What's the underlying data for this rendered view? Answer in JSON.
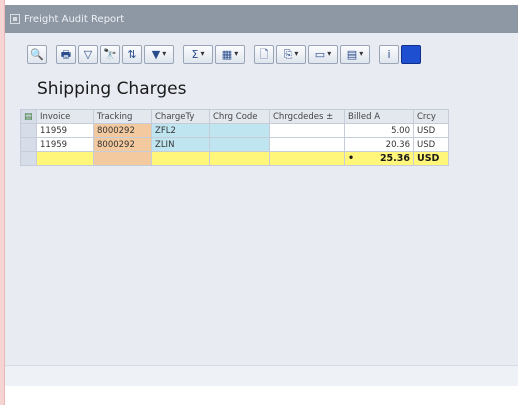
{
  "window": {
    "title": "Freight Audit Report"
  },
  "page": {
    "heading": "Shipping Charges"
  },
  "toolbar": {
    "buttons": [
      {
        "icon": "magnify-icon",
        "glyph": "🔍"
      },
      {
        "icon": "print-icon",
        "glyph": "🖶"
      },
      {
        "icon": "filter-icon",
        "glyph": "▽"
      },
      {
        "icon": "find-icon",
        "glyph": "🔭"
      },
      {
        "icon": "sort-icon",
        "glyph": "⇅"
      },
      {
        "icon": "filter-dropdown-icon",
        "glyph": "▼"
      },
      {
        "icon": "subtotal-icon",
        "glyph": "Σ"
      },
      {
        "icon": "layout-icon",
        "glyph": "▦"
      },
      {
        "icon": "document-icon",
        "glyph": "🗋"
      },
      {
        "icon": "export-icon",
        "glyph": "⎘"
      },
      {
        "icon": "view-icon",
        "glyph": "▭"
      },
      {
        "icon": "chart-icon",
        "glyph": "▤"
      },
      {
        "icon": "info-icon",
        "glyph": "i"
      }
    ]
  },
  "table": {
    "columns": [
      "Invoice",
      "Tracking",
      "ChargeTy",
      "Chrg Code",
      "Chrgcdedes",
      "Billed A",
      "Crcy"
    ],
    "sort_marker": "±",
    "rows": [
      {
        "invoice": "11959",
        "tracking": "8000292",
        "charge_type": "ZFL2",
        "chrg_code": "",
        "chrg_desc": "",
        "billed": "5.00",
        "currency": "USD"
      },
      {
        "invoice": "11959",
        "tracking": "8000292",
        "charge_type": "ZLIN",
        "chrg_code": "",
        "chrg_desc": "",
        "billed": "20.36",
        "currency": "USD"
      }
    ],
    "total": {
      "marker": "•",
      "billed": "25.36",
      "currency": "USD"
    }
  },
  "colors": {
    "tracking_bg": "#f3caa0",
    "charge_bg": "#bfe6f0",
    "total_bg": "#fff67a",
    "titlebar_bg": "#8e97a4",
    "page_bg": "#f7d4d4"
  }
}
